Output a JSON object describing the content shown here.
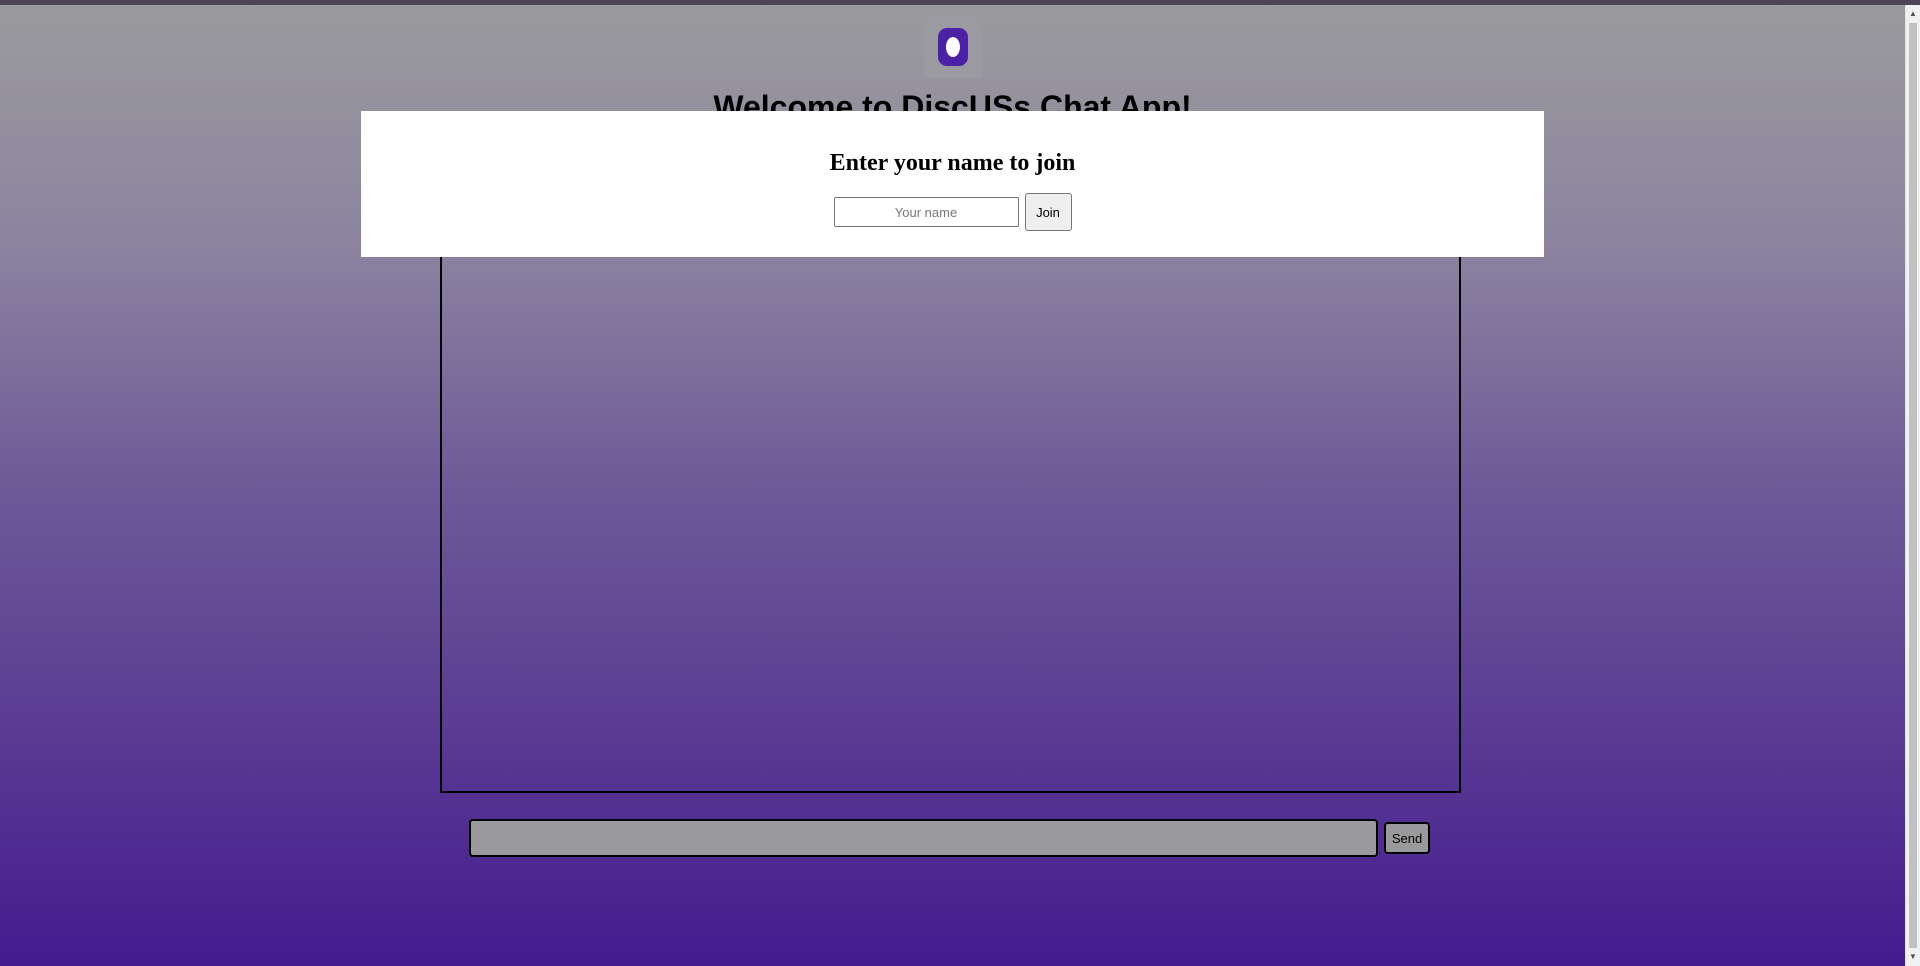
{
  "header": {
    "logo_icon": "chat-bubble-logo-icon",
    "title": "Welcome to DiscUSs Chat App!"
  },
  "modal": {
    "title": "Enter your name to join",
    "name_placeholder": "Your name",
    "name_value": "",
    "join_label": "Join"
  },
  "composer": {
    "message_value": "",
    "send_label": "Send"
  },
  "scrollbar": {
    "up_icon": "▲",
    "down_icon": "▼"
  },
  "colors": {
    "gradient_top": "#9b9b9d",
    "gradient_bottom": "#441b8f",
    "logo": "#4b22a6",
    "modal_background": "#ffffff"
  }
}
